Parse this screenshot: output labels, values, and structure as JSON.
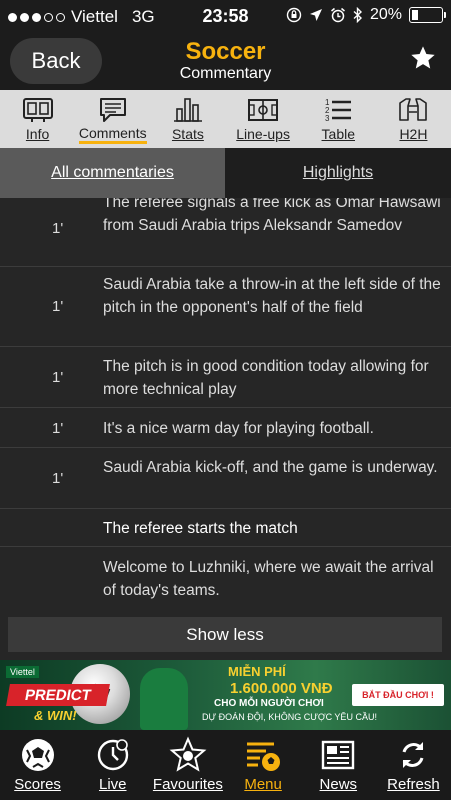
{
  "status_bar": {
    "carrier": "Viettel",
    "network": "3G",
    "time": "23:58",
    "battery": "20%",
    "battery_level": 0.2
  },
  "header": {
    "back_label": "Back",
    "title": "Soccer",
    "subtitle": "Commentary",
    "favorite_icon": "star-icon"
  },
  "tabs": [
    {
      "label": "Info",
      "icon": "scoreboard-icon",
      "active": false
    },
    {
      "label": "Comments",
      "icon": "comment-icon",
      "active": true
    },
    {
      "label": "Stats",
      "icon": "bar-chart-icon",
      "active": false
    },
    {
      "label": "Line-ups",
      "icon": "pitch-icon",
      "active": false
    },
    {
      "label": "Table",
      "icon": "ranked-list-icon",
      "active": false
    },
    {
      "label": "H2H",
      "icon": "jerseys-icon",
      "active": false
    }
  ],
  "segments": {
    "all_label": "All commentaries",
    "highlights_label": "Highlights"
  },
  "commentary": [
    {
      "minute": "1'",
      "text": "The referee signals a free kick as Omar Hawsawi from Saudi Arabia trips Aleksandr Samedov"
    },
    {
      "minute": "1'",
      "text": "Saudi Arabia take a throw-in at the left side of the pitch in the opponent's half of the field"
    },
    {
      "minute": "1'",
      "text": "The pitch is in good condition today allowing for more technical play"
    },
    {
      "minute": "1'",
      "text": "It's a nice warm day for playing football."
    },
    {
      "minute": "1'",
      "text": "Saudi Arabia kick-off, and the game is underway."
    },
    {
      "minute": "",
      "text": "The referee starts the match"
    },
    {
      "minute": "",
      "text": "Welcome to Luzhniki, where we await the arrival of today's teams."
    }
  ],
  "show_less_label": "Show less",
  "ad": {
    "brand": "Viettel",
    "predict": "PREDICT",
    "win": "& WIN!",
    "free": "MIỄN PHÍ",
    "amount": "1.600.000 VNĐ",
    "per_player": "CHO MỖI NGƯỜI CHƠI",
    "guess": "DỰ ĐOÁN ĐỘI, KHÔNG CƯỢC YÊU CẦU!",
    "cta": "BẮT ĐẦU CHƠI !"
  },
  "bottom_nav": [
    {
      "label": "Scores",
      "icon": "soccer-ball-icon",
      "active": false
    },
    {
      "label": "Live",
      "icon": "live-ball-icon",
      "active": false
    },
    {
      "label": "Favourites",
      "icon": "star-ball-icon",
      "active": false
    },
    {
      "label": "Menu",
      "icon": "menu-ball-icon",
      "active": true
    },
    {
      "label": "News",
      "icon": "newspaper-icon",
      "active": false
    },
    {
      "label": "Refresh",
      "icon": "refresh-icon",
      "active": false
    }
  ],
  "colors": {
    "accent": "#f7b20f",
    "background": "#262626",
    "tab_bar": "#dcdcdc"
  }
}
